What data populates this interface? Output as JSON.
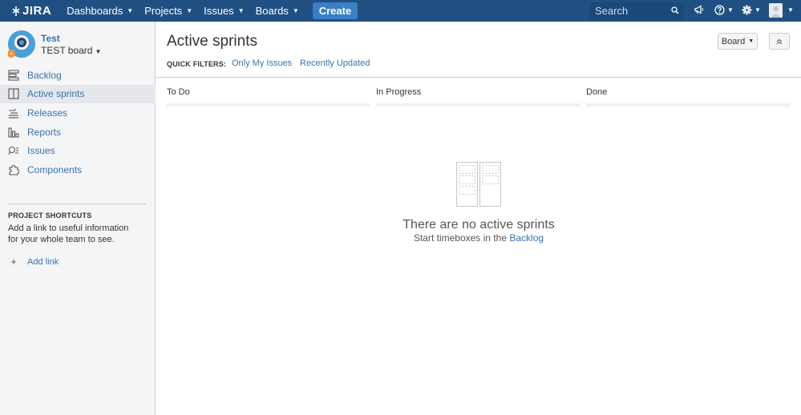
{
  "header": {
    "logo_text": "JIRA",
    "nav": [
      {
        "label": "Dashboards"
      },
      {
        "label": "Projects"
      },
      {
        "label": "Issues"
      },
      {
        "label": "Boards"
      }
    ],
    "create_label": "Create",
    "search_placeholder": "Search",
    "icons": [
      "megaphone-icon",
      "help-icon",
      "gear-icon",
      "user-avatar"
    ]
  },
  "sidebar": {
    "project_name": "Test",
    "board_name": "TEST board",
    "items": [
      {
        "label": "Backlog",
        "icon": "backlog-icon",
        "active": false
      },
      {
        "label": "Active sprints",
        "icon": "active-sprints-icon",
        "active": true
      },
      {
        "label": "Releases",
        "icon": "releases-icon",
        "active": false
      },
      {
        "label": "Reports",
        "icon": "reports-icon",
        "active": false
      },
      {
        "label": "Issues",
        "icon": "issues-icon",
        "active": false
      },
      {
        "label": "Components",
        "icon": "components-icon",
        "active": false
      }
    ],
    "shortcuts_title": "PROJECT SHORTCUTS",
    "shortcuts_desc": "Add a link to useful information for your whole team to see.",
    "add_link_label": "Add link"
  },
  "main": {
    "title": "Active sprints",
    "board_button": "Board",
    "quick_filters_label": "QUICK FILTERS:",
    "quick_filters": [
      "Only My Issues",
      "Recently Updated"
    ],
    "columns": [
      "To Do",
      "In Progress",
      "Done"
    ],
    "empty_title": "There are no active sprints",
    "empty_sub_prefix": "Start timeboxes in the",
    "empty_sub_link": "Backlog"
  },
  "colors": {
    "header_bg": "#205081",
    "create_bg": "#3b7fc4",
    "link": "#3b73af",
    "sidebar_bg": "#f4f5f7"
  }
}
